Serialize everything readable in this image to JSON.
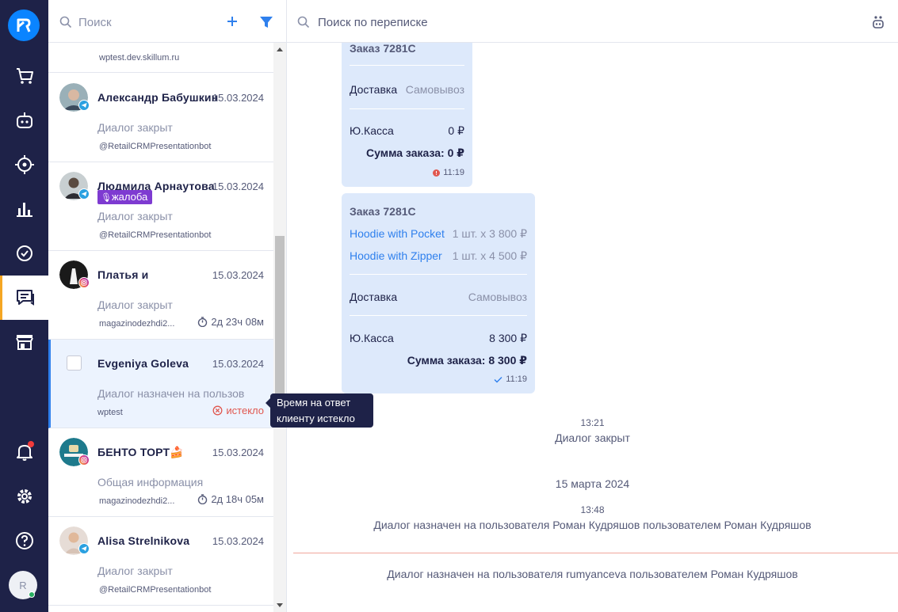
{
  "sidebar": {
    "nav": [
      "cart-icon",
      "bot-icon",
      "target-icon",
      "analytics-icon",
      "tasks-icon",
      "chats-icon",
      "store-icon",
      "bell-icon",
      "settings-icon",
      "help-icon"
    ],
    "active": "chats-icon",
    "avatar_letter": "R",
    "colors": {
      "bg": "#1e2248",
      "logo": "#0a84ff",
      "active_marker": "#f5a623",
      "notify": "#f23b3b",
      "online": "#27ae60"
    }
  },
  "chat_list": {
    "search_placeholder": "Поиск",
    "first_partial_channel": "wptest.dev.skillum.ru",
    "items": [
      {
        "name": "Александр Бабушкин",
        "date": "15.03.2024",
        "status": "Диалог закрыт",
        "channel": "@RetailCRMPresentationbot",
        "source": "telegram"
      },
      {
        "name": "Людмила Арнаутова",
        "date": "15.03.2024",
        "tag": "жалоба",
        "status": "Диалог закрыт",
        "channel": "@RetailCRMPresentationbot",
        "source": "telegram"
      },
      {
        "name": "Платья и",
        "date": "15.03.2024",
        "status": "Диалог закрыт",
        "channel": "magazinodezhdi2...",
        "timer": "2д 23ч 08м",
        "source": "instagram"
      },
      {
        "name": "Evgeniya Goleva",
        "date": "15.03.2024",
        "status": "Диалог назначен на пользов",
        "channel": "wptest",
        "expired": "истекло",
        "selected": true
      },
      {
        "name": "БЕНТО ТОРТ🍰",
        "date": "15.03.2024",
        "status": "Общая информация",
        "channel": "magazinodezhdi2...",
        "timer": "2д 18ч 05м",
        "source": "instagram"
      },
      {
        "name": "Alisa Strelnikova",
        "date": "15.03.2024",
        "status": "Диалог закрыт",
        "channel": "@RetailCRMPresentationbot",
        "source": "telegram"
      }
    ],
    "tooltip": "Время на ответ клиенту истекло",
    "colors": {
      "selected_bg": "#ecf3fe",
      "accent": "#2f80ed",
      "tag_bg": "#7e3bd1",
      "expired": "#e0574f"
    }
  },
  "chat": {
    "search_placeholder": "Поиск по переписке",
    "order1": {
      "title": "Заказ 7281С",
      "delivery_label": "Доставка",
      "delivery_value": "Самовывоз",
      "payment_label": "Ю.Касса",
      "payment_value": "0 ₽",
      "total": "Сумма заказа: 0 ₽",
      "time": "11:19",
      "status": "error"
    },
    "order2": {
      "title": "Заказ 7281С",
      "items": [
        {
          "name": "Hoodie with Pocket",
          "qty": "1 шт. x 3 800 ₽"
        },
        {
          "name": "Hoodie with Zipper",
          "qty": "1 шт. x 4 500 ₽"
        }
      ],
      "delivery_label": "Доставка",
      "delivery_value": "Самовывоз",
      "payment_label": "Ю.Касса",
      "payment_value": "8 300 ₽",
      "total": "Сумма заказа: 8 300 ₽",
      "time": "11:19",
      "status": "delivered"
    },
    "events": [
      {
        "time": "13:21",
        "text": "Диалог закрыт"
      },
      {
        "date": "15 марта 2024"
      },
      {
        "time": "13:48",
        "text": "Диалог назначен на пользователя Роман Кудряшов пользователем Роман Кудряшов"
      },
      {
        "text": "Диалог назначен на пользователя rumyanceva пользователем Роман Кудряшов"
      }
    ],
    "colors": {
      "bubble": "#dde9fb",
      "link": "#2f80ed",
      "unread_line": "#f0a69b"
    }
  }
}
